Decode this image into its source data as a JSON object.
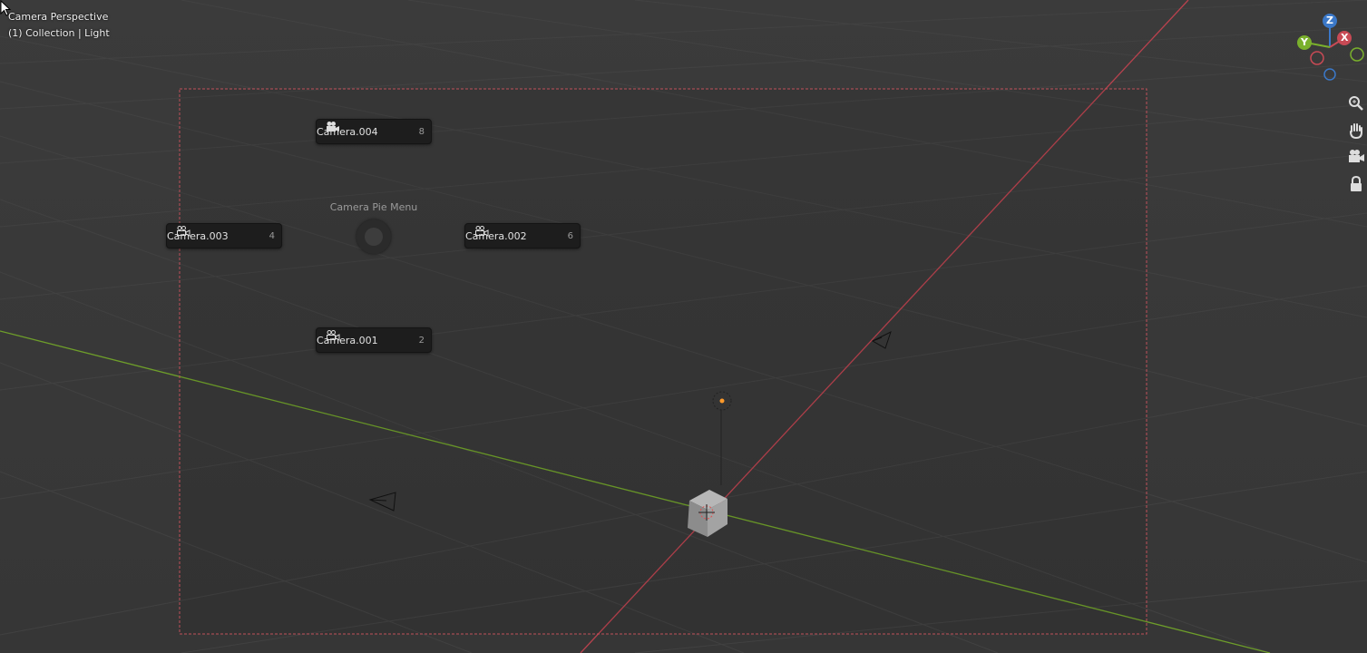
{
  "viewport": {
    "view_name": "Camera Perspective",
    "context": "(1) Collection | Light"
  },
  "pie_menu": {
    "title": "Camera Pie Menu",
    "items": [
      {
        "label": "Camera.004",
        "key": "8"
      },
      {
        "label": "Camera.003",
        "key": "4"
      },
      {
        "label": "Camera.002",
        "key": "6"
      },
      {
        "label": "Camera.001",
        "key": "2"
      }
    ]
  },
  "gizmo": {
    "z_label": "Z",
    "x_label": "X",
    "y_label": "Y"
  },
  "colors": {
    "background": "#393939",
    "x_axis": "#c84a55",
    "y_axis": "#7ab02c",
    "z_axis": "#3b78c8",
    "light_origin": "#ff9a2a"
  },
  "icons": {
    "zoom": "magnifier-icon",
    "pan": "hand-icon",
    "camera_view": "camera-icon",
    "lock": "lock-icon"
  }
}
